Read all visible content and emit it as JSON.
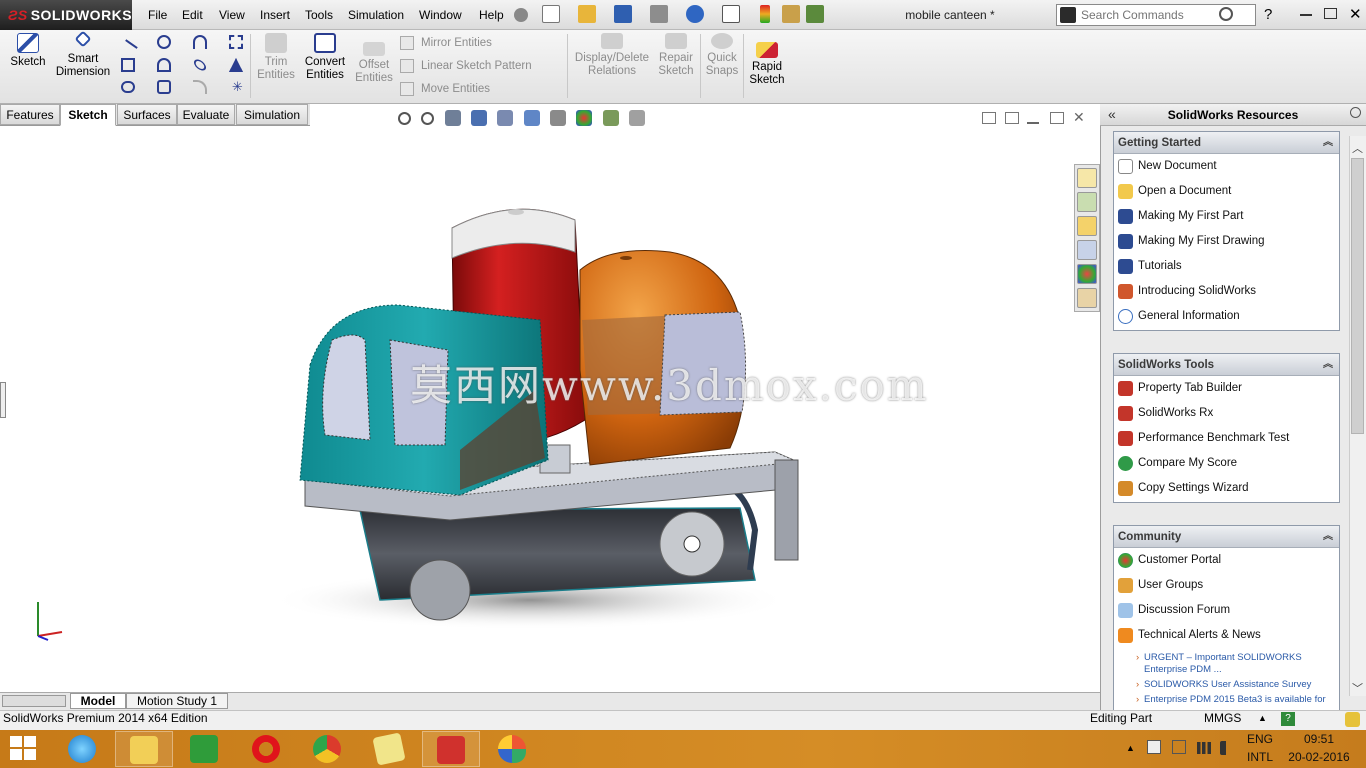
{
  "app": {
    "brand": "SOLIDWORKS",
    "document_title": "mobile canteen *"
  },
  "menubar": {
    "items": [
      "File",
      "Edit",
      "View",
      "Insert",
      "Tools",
      "Simulation",
      "Window",
      "Help"
    ]
  },
  "search": {
    "placeholder": "Search Commands"
  },
  "ribbon": {
    "sketch": "Sketch",
    "smart_dimension": [
      "Smart",
      "Dimension"
    ],
    "trim_entities": [
      "Trim",
      "Entities"
    ],
    "convert_entities": [
      "Convert",
      "Entities"
    ],
    "offset_entities": [
      "Offset",
      "Entities"
    ],
    "mirror_entities": "Mirror Entities",
    "linear_sketch_pattern": "Linear Sketch Pattern",
    "move_entities": "Move Entities",
    "display_delete_relations": [
      "Display/Delete",
      "Relations"
    ],
    "repair_sketch": [
      "Repair",
      "Sketch"
    ],
    "quick_snaps": [
      "Quick",
      "Snaps"
    ],
    "rapid_sketch": [
      "Rapid",
      "Sketch"
    ]
  },
  "tabs": [
    {
      "label": "Features",
      "active": false
    },
    {
      "label": "Sketch",
      "active": true
    },
    {
      "label": "Surfaces",
      "active": false
    },
    {
      "label": "Evaluate",
      "active": false
    },
    {
      "label": "Simulation",
      "active": false
    }
  ],
  "watermark": "莫西网www.3dmox.com",
  "task_pane": {
    "title": "SolidWorks Resources",
    "getting_started": {
      "title": "Getting Started",
      "items": [
        "New Document",
        "Open a Document",
        "Making My First Part",
        "Making My First Drawing",
        "Tutorials",
        "Introducing SolidWorks",
        "General Information"
      ]
    },
    "solidworks_tools": {
      "title": "SolidWorks Tools",
      "items": [
        "Property Tab Builder",
        "SolidWorks Rx",
        "Performance Benchmark Test",
        "Compare My Score",
        "Copy Settings Wizard"
      ]
    },
    "community": {
      "title": "Community",
      "items": [
        "Customer Portal",
        "User Groups",
        "Discussion Forum",
        "Technical Alerts & News"
      ],
      "news": [
        "URGENT – Important SOLIDWORKS Enterprise PDM ...",
        "SOLIDWORKS User Assistance Survey",
        "Enterprise PDM 2015 Beta3 is available for"
      ]
    }
  },
  "bottom_tabs": [
    {
      "label": "Model",
      "active": true
    },
    {
      "label": "Motion Study 1",
      "active": false
    }
  ],
  "status": {
    "edition": "SolidWorks Premium 2014 x64 Edition",
    "mode": "Editing Part",
    "units": "MMGS"
  },
  "tray": {
    "language": "ENG",
    "layout": "INTL",
    "time": "09:51",
    "date": "20-02-2016"
  },
  "taskbar_apps": [
    "start-icon",
    "internet-explorer-icon",
    "file-explorer-icon",
    "store-icon",
    "opera-icon",
    "chrome-icon",
    "sticky-notes-icon",
    "solidworks-icon",
    "paint-icon"
  ],
  "colors": {
    "cab": "#1a9aa0",
    "can": "#c81e1e",
    "dome": "#d06a12",
    "chassis": "#b9bdc7",
    "body": "#3a3d44",
    "taskbar": "#c67a18"
  }
}
